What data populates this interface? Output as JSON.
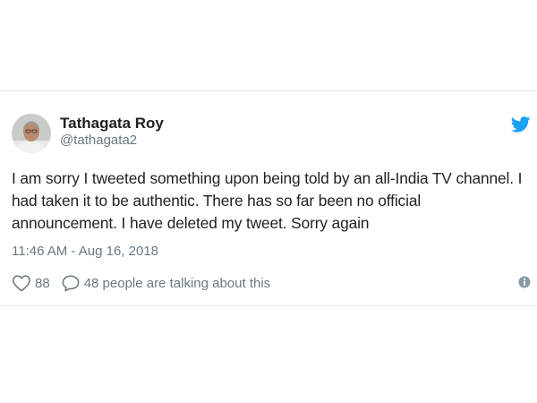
{
  "author": {
    "display_name": "Tathagata Roy",
    "handle": "@tathagata2",
    "avatar_icon": "avatar-photo"
  },
  "tweet": {
    "text": "I am sorry I tweeted something upon being told by an all-India TV channel. I had taken it to be authentic. There has so far been no official announcement. I have deleted my tweet. Sorry again",
    "timestamp": "11:46 AM - Aug 16, 2018"
  },
  "actions": {
    "like_count": "88",
    "reply_text": "48 people are talking about this"
  },
  "icons": {
    "brand": "twitter-bird-icon",
    "like": "heart-icon",
    "reply": "speech-bubble-icon",
    "info": "info-icon"
  },
  "colors": {
    "brand": "#1da1f2",
    "text": "#1c2022",
    "muted": "#697882",
    "border": "#e1e8ed"
  }
}
